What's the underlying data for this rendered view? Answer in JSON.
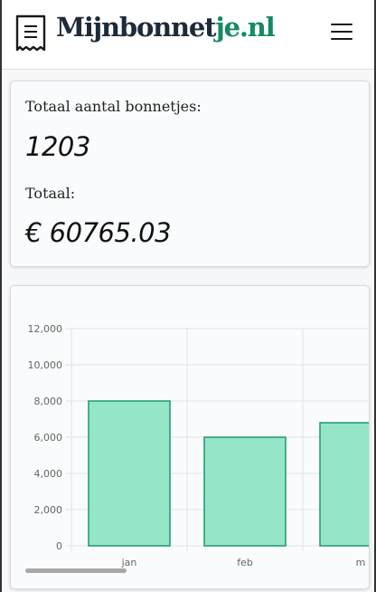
{
  "app": {
    "brand_dark": "Mijnbonnet",
    "brand_green": "je.nl",
    "logo_icon": "receipt-icon",
    "menu_icon": "hamburger-menu-icon",
    "colors": {
      "brand_dark": "#1c2b3a",
      "brand_green": "#168a63",
      "bar_fill": "#95e6c8",
      "bar_stroke": "#1a9a6c"
    }
  },
  "stats": {
    "count_label": "Totaal aantal bonnetjes:",
    "count_value": "1203",
    "total_label": "Totaal:",
    "total_value": "€ 60765.03"
  },
  "chart_data": {
    "type": "bar",
    "categories": [
      "jan",
      "feb",
      "m"
    ],
    "values": [
      8000,
      6000,
      6800
    ],
    "ylim": [
      0,
      12000
    ],
    "yticks": [
      "0",
      "2,000",
      "4,000",
      "6,000",
      "8,000",
      "10,000",
      "12,000"
    ],
    "grid": true
  }
}
